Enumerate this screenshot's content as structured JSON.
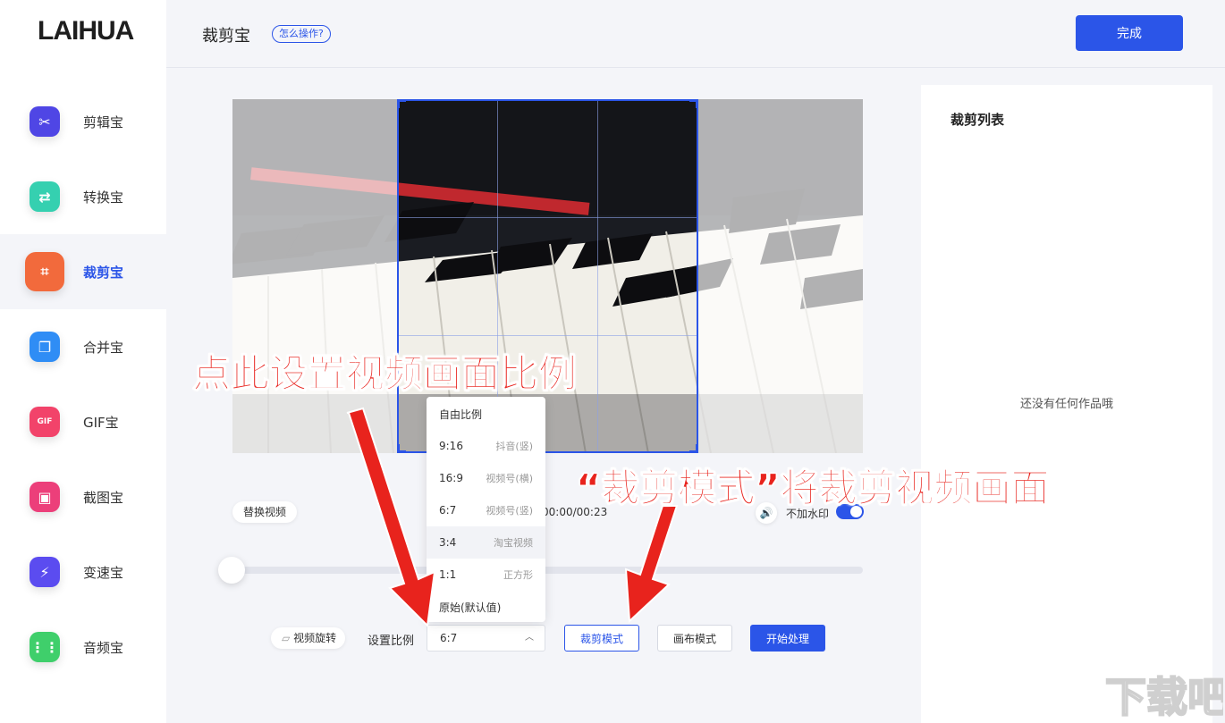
{
  "app": {
    "logo": "LAIHUA",
    "title": "裁剪宝",
    "help": "怎么操作?",
    "done": "完成"
  },
  "colors": {
    "accent": "#2b55e8",
    "annotation": "#e8231d"
  },
  "sidebar": {
    "items": [
      {
        "label": "剪辑宝",
        "icon": "scissors-icon",
        "color": "#4f46e5",
        "glyph": "✂"
      },
      {
        "label": "转换宝",
        "icon": "convert-icon",
        "color": "#35d0b0",
        "glyph": "⇄"
      },
      {
        "label": "裁剪宝",
        "icon": "crop-icon",
        "color": "#f26a3c",
        "glyph": "⌗",
        "active": true
      },
      {
        "label": "合并宝",
        "icon": "merge-icon",
        "color": "#2f8df5",
        "glyph": "❐"
      },
      {
        "label": "GIF宝",
        "icon": "gif-icon",
        "color": "#f2436a",
        "glyph": "GIF"
      },
      {
        "label": "截图宝",
        "icon": "screenshot-icon",
        "color": "#ec3f7a",
        "glyph": "▣"
      },
      {
        "label": "变速宝",
        "icon": "speed-icon",
        "color": "#5b4cf0",
        "glyph": "⚡"
      },
      {
        "label": "音频宝",
        "icon": "audio-icon",
        "color": "#3fcf6b",
        "glyph": "⋮⋮"
      }
    ]
  },
  "right_panel": {
    "title": "裁剪列表",
    "empty": "还没有任何作品哦"
  },
  "player": {
    "replace": "替换视频",
    "time": "00:00/00:23",
    "watermark_label": "不加水印",
    "watermark_on": true,
    "progress": 0
  },
  "ratio_menu": {
    "items": [
      {
        "ratio": "自由比例",
        "desc": ""
      },
      {
        "ratio": "9:16",
        "desc": "抖音(竖)"
      },
      {
        "ratio": "16:9",
        "desc": "视频号(横)"
      },
      {
        "ratio": "6:7",
        "desc": "视频号(竖)"
      },
      {
        "ratio": "3:4",
        "desc": "淘宝视频",
        "highlighted": true
      },
      {
        "ratio": "1:1",
        "desc": "正方形"
      },
      {
        "ratio": "原始(默认值)",
        "desc": ""
      }
    ]
  },
  "controls": {
    "rotate": "视频旋转",
    "ratio_label": "设置比例",
    "ratio_value": "6:7",
    "crop_mode": "裁剪模式",
    "canvas_mode": "画布模式",
    "start": "开始处理"
  },
  "annotations": {
    "top": "点此设置视频画面比例",
    "right": "“裁剪模式”将裁剪视频画面"
  },
  "watermark": {
    "brand": "下载吧"
  }
}
